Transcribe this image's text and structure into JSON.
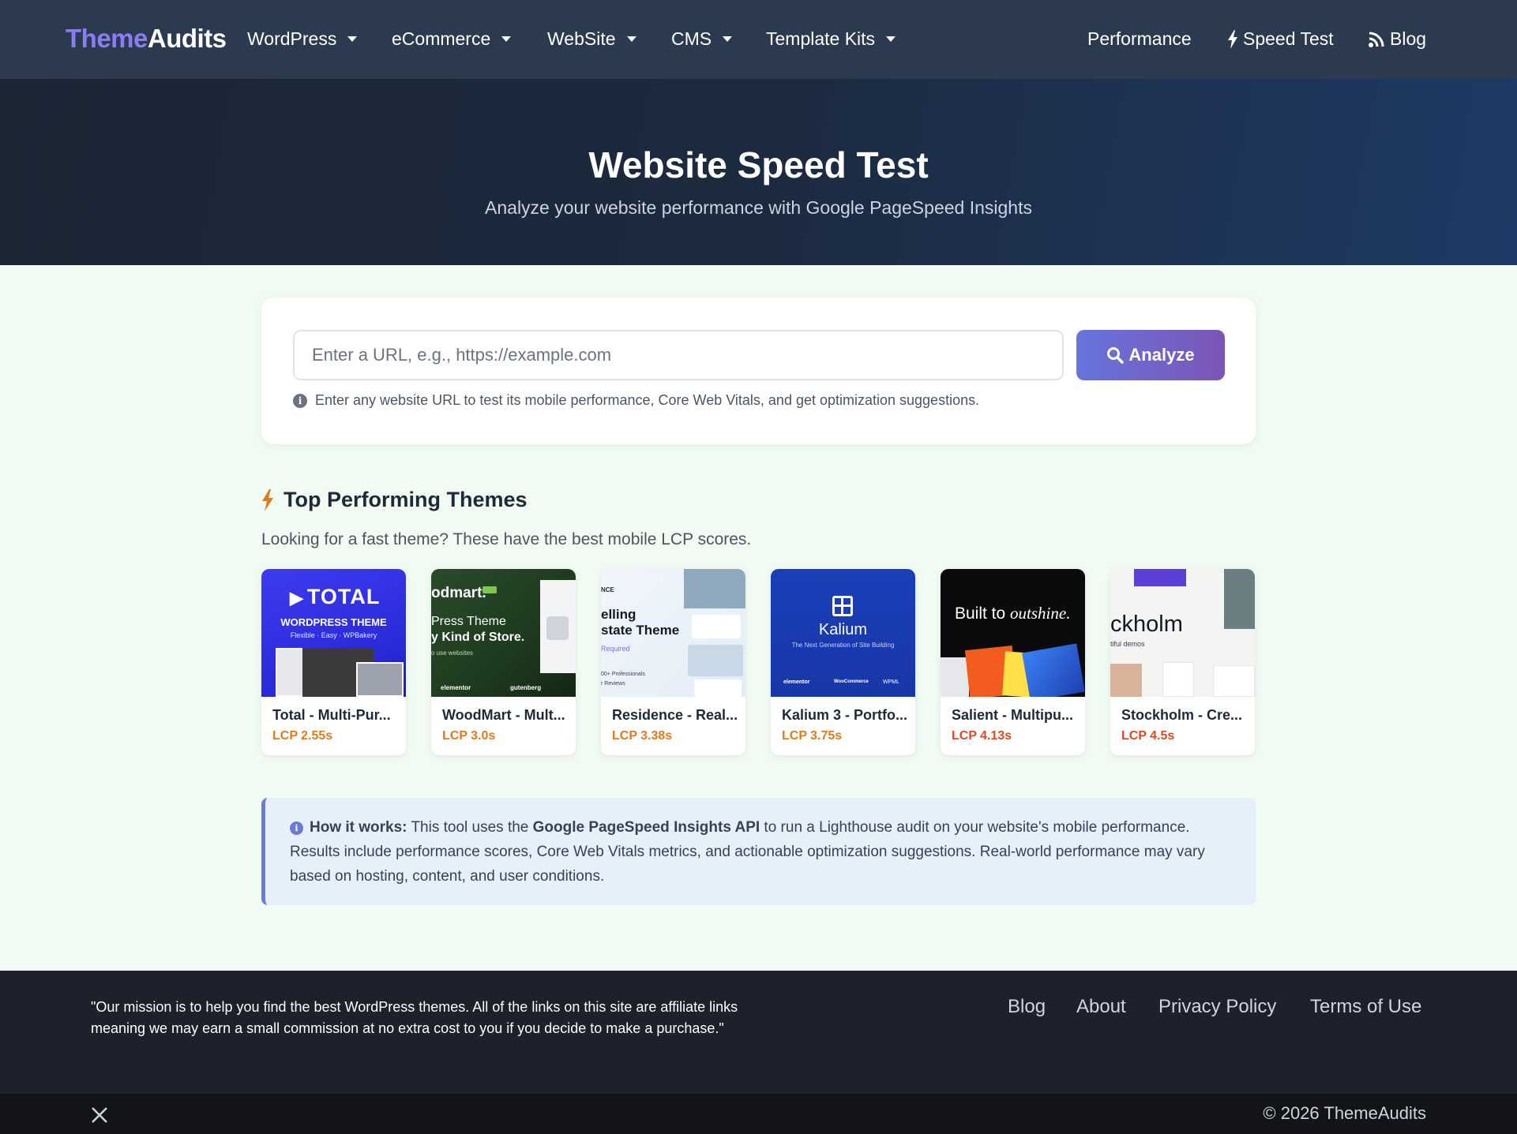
{
  "nav": {
    "brand_part1": "Theme",
    "brand_part2": "Audits",
    "items": [
      {
        "label": "WordPress"
      },
      {
        "label": "eCommerce"
      },
      {
        "label": "WebSite"
      },
      {
        "label": "CMS"
      },
      {
        "label": "Template Kits"
      }
    ],
    "right": {
      "performance": "Performance",
      "speed_test": "Speed Test",
      "blog": "Blog"
    }
  },
  "hero": {
    "title": "Website Speed Test",
    "subtitle": "Analyze your website performance with Google PageSpeed Insights"
  },
  "search": {
    "placeholder": "Enter a URL, e.g., https://example.com",
    "value": "",
    "button_label": "Analyze",
    "hint": "Enter any website URL to test its mobile performance, Core Web Vitals, and get optimization suggestions."
  },
  "top_themes": {
    "title": "Top Performing Themes",
    "subtitle": "Looking for a fast theme? These have the best mobile LCP scores.",
    "themes": [
      {
        "name": "Total - Multi-Pur...",
        "lcp": "LCP 2.55s",
        "lcp_color": "#e07a1f",
        "thumb": {
          "l1": "TOTAL",
          "l2": "WORDPRESS THEME",
          "l3": "Flexible · Easy · WPBakery"
        }
      },
      {
        "name": "WoodMart - Mult...",
        "lcp": "LCP 3.0s",
        "lcp_color": "#e07a1f",
        "thumb": {
          "l1": "odmart.",
          "l2": "Press Theme",
          "l3": "y Kind of Store.",
          "l4": "o use websites",
          "l5": "elementor",
          "l6": "gutenberg"
        }
      },
      {
        "name": "Residence - Real...",
        "lcp": "LCP 3.38s",
        "lcp_color": "#e07a1f",
        "thumb": {
          "l1": "NCE",
          "l2": "elling",
          "l3": "state Theme",
          "l4": "Required",
          "l5": "00+ Professionals",
          "l6": "r Reviews"
        }
      },
      {
        "name": "Kalium 3 - Portfo...",
        "lcp": "LCP 3.75s",
        "lcp_color": "#e07a1f",
        "thumb": {
          "l1": "Kalium",
          "l2": "The Next Generation of Site Building",
          "l3": "elementor",
          "l4": "WooCommerce",
          "l5": "WPML"
        }
      },
      {
        "name": "Salient - Multipu...",
        "lcp": "LCP 4.13s",
        "lcp_color": "#e0481f",
        "thumb": {
          "l1": "Built to",
          "l2": "outshine."
        }
      },
      {
        "name": "Stockholm - Cre...",
        "lcp": "LCP 4.5s",
        "lcp_color": "#e0481f",
        "thumb": {
          "l1": "ckholm",
          "l2": "tiful demos"
        }
      }
    ]
  },
  "info": {
    "lead": "How it works:",
    "text1": " This tool uses the ",
    "bold": "Google PageSpeed Insights API",
    "text2": " to run a Lighthouse audit on your website's mobile performance. Results include performance scores, Core Web Vitals metrics, and actionable optimization suggestions. Real-world performance may vary based on hosting, content, and user conditions."
  },
  "footer": {
    "mission": "\"Our mission is to help you find the best WordPress themes. All of the links on this site are affiliate links meaning we may earn a small commission at no extra cost to you if you decide to make a purchase.\"",
    "links": [
      "Blog",
      "About",
      "Privacy Policy",
      "Terms of Use"
    ],
    "copyright": "© 2026 ThemeAudits"
  },
  "colors": {
    "nav_bg": "#2b3a4e",
    "brand_accent": "#8b7cf6",
    "analyze_btn": "#6e6ad4",
    "lcp_orange": "#e07a1f",
    "lcp_red": "#e0481f",
    "page_bg": "#f0fbf3",
    "info_bg": "#e6f0fb"
  },
  "icons": [
    "caret-down-icon",
    "bolt-icon",
    "rss-icon",
    "search-icon",
    "info-icon",
    "x-logo-icon"
  ]
}
